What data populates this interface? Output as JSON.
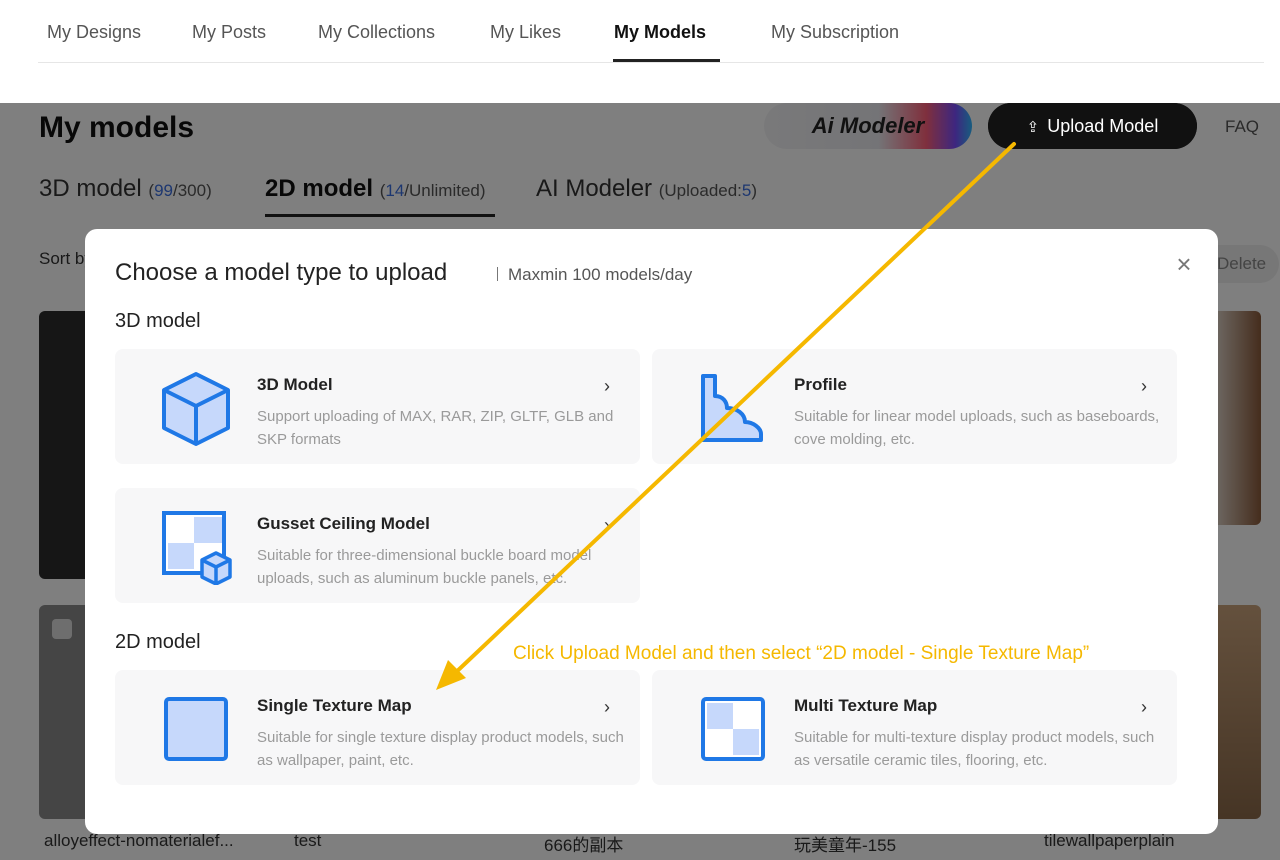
{
  "topnav": {
    "tabs": [
      {
        "label": "My Designs"
      },
      {
        "label": "My Posts"
      },
      {
        "label": "My Collections"
      },
      {
        "label": "My Likes"
      },
      {
        "label": "My Models"
      },
      {
        "label": "My Subscription"
      }
    ],
    "active_tab": "My Models"
  },
  "page": {
    "title": "My models",
    "ai_modeler_label": "Ai Modeler",
    "upload_label": "Upload Model",
    "faq_label": "FAQ",
    "sort_label": "Sort by",
    "delete_label": "Delete",
    "subtabs": [
      {
        "name": "3D model",
        "count": "99",
        "limit": "/300)",
        "open": "("
      },
      {
        "name": "2D model",
        "count": "14",
        "limit": "/Unlimited)",
        "open": "("
      },
      {
        "name": "AI Modeler",
        "count": "5",
        "limit": ")",
        "open": "(Uploaded:"
      }
    ],
    "captions": [
      "alloyeffect-nomaterialef...",
      "test",
      "666的副本",
      "玩美童年-155",
      "tilewallpaperplain"
    ]
  },
  "modal": {
    "title": "Choose a model type to upload",
    "subtitle": "Maxmin 100 models/day",
    "section_3d": "3D model",
    "section_2d": "2D model",
    "options": [
      {
        "title": "3D Model",
        "desc": "Support uploading of MAX, RAR, ZIP, GLTF, GLB and SKP formats",
        "icon": "cube-icon"
      },
      {
        "title": "Profile",
        "desc": "Suitable for linear model uploads, such as baseboards, cove molding, etc.",
        "icon": "profile-icon"
      },
      {
        "title": "Gusset Ceiling Model",
        "desc": "Suitable for three-dimensional buckle board model uploads, such as aluminum buckle panels, etc.",
        "icon": "gusset-icon"
      },
      {
        "title": "Single Texture Map",
        "desc": "Suitable for single texture display product models, such as wallpaper, paint, etc.",
        "icon": "single-texture-icon"
      },
      {
        "title": "Multi Texture Map",
        "desc": "Suitable for multi-texture display product models, such as versatile ceramic tiles, flooring, etc.",
        "icon": "multi-texture-icon"
      }
    ]
  },
  "annotation": {
    "text": "Click Upload Model and then select “2D model - Single Texture Map”",
    "color": "#f5b800"
  },
  "colors": {
    "accent_blue": "#1f78e6",
    "icon_fill": "#c6d8fb",
    "count_blue": "#3b6ee0"
  }
}
